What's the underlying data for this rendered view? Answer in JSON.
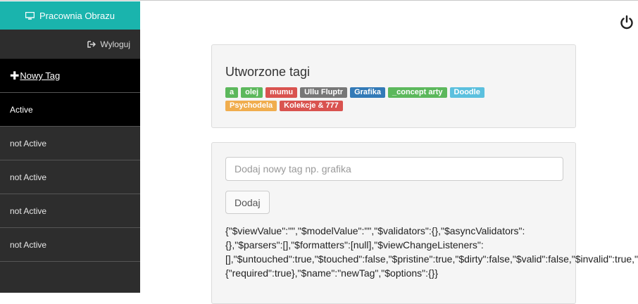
{
  "sidebar": {
    "brand": "Pracownia Obrazu",
    "logout": "Wyloguj",
    "new_tag": " Nowy Tag",
    "items": [
      "Active",
      "not Active",
      "not Active",
      "not Active",
      "not Active"
    ]
  },
  "panel1": {
    "title": "Utworzone tagi",
    "tags": [
      {
        "label": "a",
        "color": "#5cb85c"
      },
      {
        "label": "olej",
        "color": "#5cb85c"
      },
      {
        "label": "mumu",
        "color": "#d9534f"
      },
      {
        "label": "Ullu Fluptr",
        "color": "#777777"
      },
      {
        "label": "Grafika",
        "color": "#337ab7"
      },
      {
        "label": "_concept arty",
        "color": "#5cb85c"
      },
      {
        "label": "Doodle",
        "color": "#5bc0de"
      },
      {
        "label": "Psychodela",
        "color": "#f0ad4e"
      },
      {
        "label": "Kolekcje & 777",
        "color": "#d9534f"
      }
    ]
  },
  "panel2": {
    "input_placeholder": "Dodaj nowy tag np. grafika",
    "input_value": "",
    "button": "Dodaj",
    "debug_lines": [
      "{\"$viewValue\":\"\",\"$modelValue\":\"\",\"$validators\":{},\"$asyncValidators\":",
      "{},\"$parsers\":[],\"$formatters\":[null],\"$viewChangeListeners\":",
      "[],\"$untouched\":true,\"$touched\":false,\"$pristine\":true,\"$dirty\":false,\"$valid\":false,\"$invalid\":true,\"$error\":",
      "{\"required\":true},\"$name\":\"newTag\",\"$options\":{}}"
    ]
  },
  "colors": {
    "brand": "#1ab4ad",
    "sidebar": "#2d2d2d",
    "active": "#000000"
  },
  "icons": [
    "monitor-icon",
    "logout-icon",
    "plus-icon",
    "power-icon"
  ]
}
